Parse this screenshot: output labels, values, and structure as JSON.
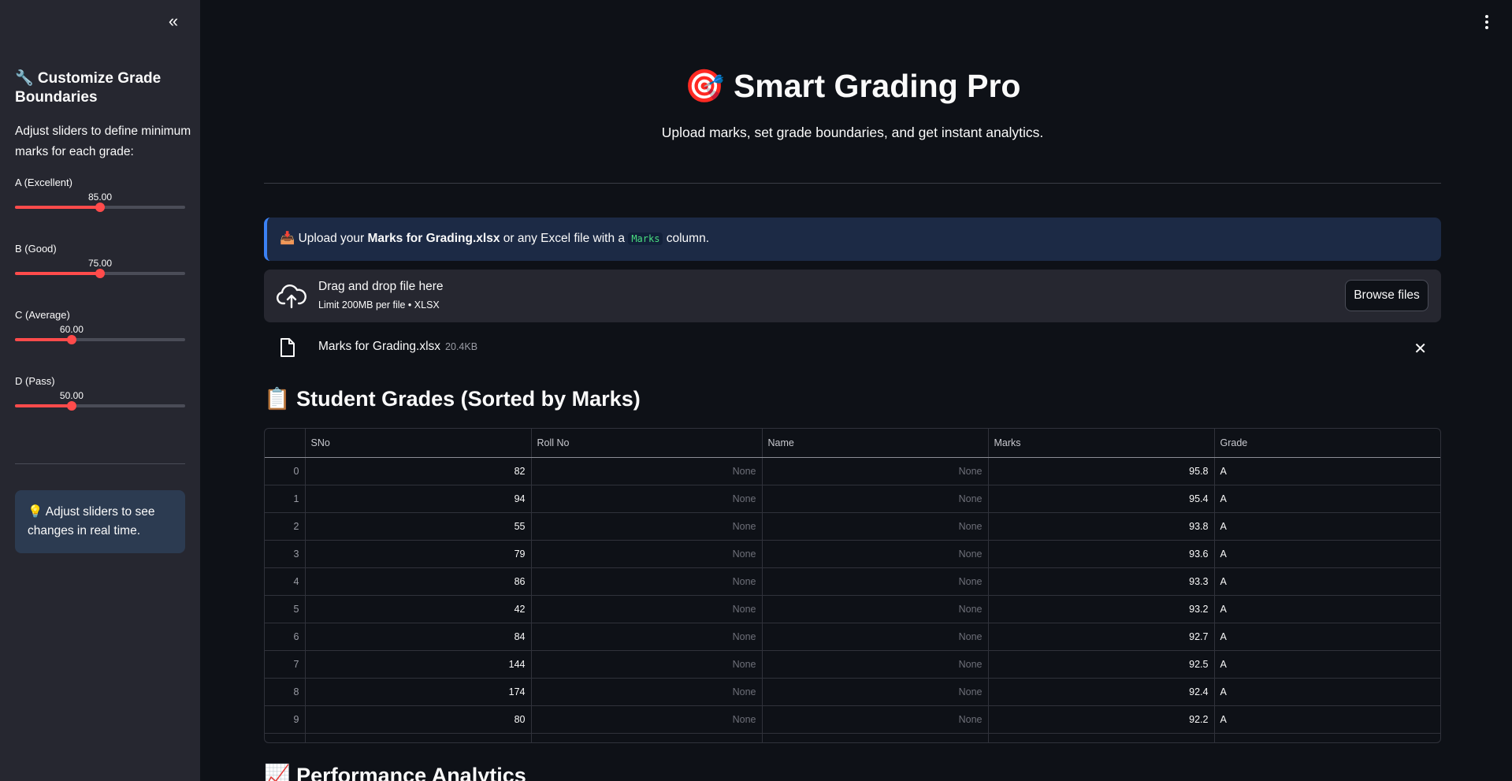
{
  "sidebar": {
    "collapse_icon": "«",
    "title": "🔧 Customize Grade Boundaries",
    "description": "Adjust sliders to define minimum marks for each grade:",
    "sliders": [
      {
        "label": "A (Excellent)",
        "value": "85.00",
        "fraction": 0.5
      },
      {
        "label": "B (Good)",
        "value": "75.00",
        "fraction": 0.5
      },
      {
        "label": "C (Average)",
        "value": "60.00",
        "fraction": 0.333
      },
      {
        "label": "D (Pass)",
        "value": "50.00",
        "fraction": 0.333
      }
    ],
    "info": "💡 Adjust sliders to see changes in real time."
  },
  "header": {
    "title": "🎯 Smart Grading Pro",
    "subtitle": "Upload marks, set grade boundaries, and get instant analytics."
  },
  "alert": {
    "prefix": "📥 Upload your ",
    "bold": "Marks for Grading.xlsx",
    "middle": " or any Excel file with a ",
    "code": "Marks",
    "suffix": " column."
  },
  "uploader": {
    "line1": "Drag and drop file here",
    "line2": "Limit 200MB per file • XLSX",
    "browse_label": "Browse files"
  },
  "file": {
    "name": "Marks for Grading.xlsx",
    "size": "20.4KB"
  },
  "section_grades": "📋 Student Grades (Sorted by Marks)",
  "section_analytics": "📈 Performance Analytics",
  "table": {
    "columns": [
      "SNo",
      "Roll No",
      "Name",
      "Marks",
      "Grade"
    ],
    "rows": [
      {
        "idx": "0",
        "sno": "82",
        "roll": "None",
        "name": "None",
        "marks": "95.8",
        "grade": "A"
      },
      {
        "idx": "1",
        "sno": "94",
        "roll": "None",
        "name": "None",
        "marks": "95.4",
        "grade": "A"
      },
      {
        "idx": "2",
        "sno": "55",
        "roll": "None",
        "name": "None",
        "marks": "93.8",
        "grade": "A"
      },
      {
        "idx": "3",
        "sno": "79",
        "roll": "None",
        "name": "None",
        "marks": "93.6",
        "grade": "A"
      },
      {
        "idx": "4",
        "sno": "86",
        "roll": "None",
        "name": "None",
        "marks": "93.3",
        "grade": "A"
      },
      {
        "idx": "5",
        "sno": "42",
        "roll": "None",
        "name": "None",
        "marks": "93.2",
        "grade": "A"
      },
      {
        "idx": "6",
        "sno": "84",
        "roll": "None",
        "name": "None",
        "marks": "92.7",
        "grade": "A"
      },
      {
        "idx": "7",
        "sno": "144",
        "roll": "None",
        "name": "None",
        "marks": "92.5",
        "grade": "A"
      },
      {
        "idx": "8",
        "sno": "174",
        "roll": "None",
        "name": "None",
        "marks": "92.4",
        "grade": "A"
      },
      {
        "idx": "9",
        "sno": "80",
        "roll": "None",
        "name": "None",
        "marks": "92.2",
        "grade": "A"
      }
    ]
  },
  "colors": {
    "accent": "#ff4b4b",
    "info_border": "#3b82f6",
    "code_text": "#4ade80"
  }
}
